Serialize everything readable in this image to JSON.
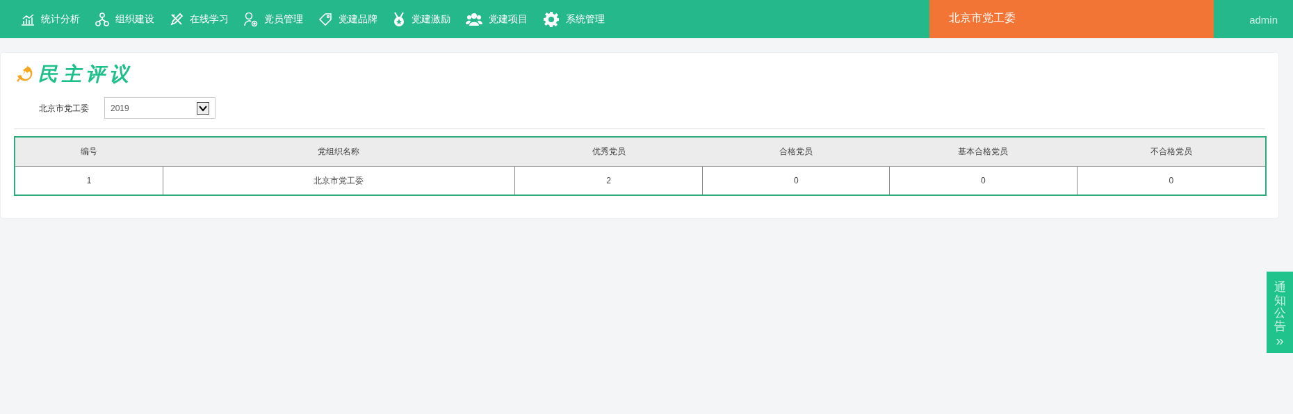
{
  "nav": [
    {
      "label": "统计分析"
    },
    {
      "label": "组织建设"
    },
    {
      "label": "在线学习"
    },
    {
      "label": "党员管理"
    },
    {
      "label": "党建品牌"
    },
    {
      "label": "党建激励"
    },
    {
      "label": "党建项目"
    },
    {
      "label": "系统管理"
    }
  ],
  "org_name": "北京市党工委",
  "user": "admin",
  "page_title": "民主评议",
  "filter": {
    "label": "北京市党工委",
    "year": "2019"
  },
  "table": {
    "columns": [
      "编号",
      "党组织名称",
      "优秀党员",
      "合格党员",
      "基本合格党员",
      "不合格党员"
    ],
    "rows": [
      [
        "1",
        "北京市党工委",
        "2",
        "0",
        "0",
        "0"
      ]
    ]
  },
  "side_tab": {
    "label": "通知公告",
    "arrow": "»"
  }
}
